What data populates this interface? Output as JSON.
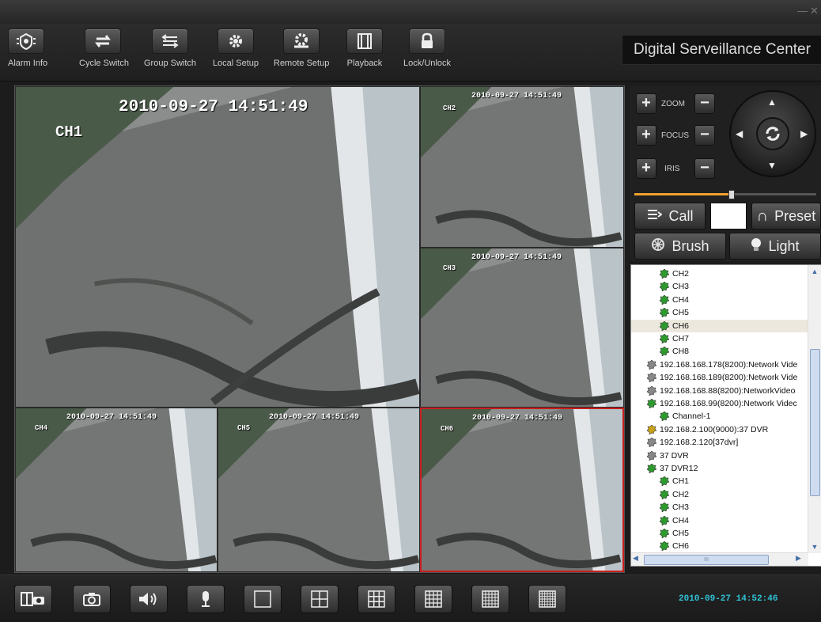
{
  "window": {
    "minimize": "—",
    "close": "✕"
  },
  "toolbar": {
    "buttons": [
      {
        "label": "Alarm Info",
        "icon": "alarm-icon"
      },
      {
        "label": "Cycle Switch",
        "icon": "cycle-icon"
      },
      {
        "label": "Group Switch",
        "icon": "group-switch-icon"
      },
      {
        "label": "Local Setup",
        "icon": "gear-icon"
      },
      {
        "label": "Remote Setup",
        "icon": "remote-gear-icon"
      },
      {
        "label": "Playback",
        "icon": "film-icon"
      },
      {
        "label": "Lock/Unlock",
        "icon": "lock-icon"
      }
    ],
    "brand": "Digital Serveillance Center"
  },
  "video": {
    "tiles": [
      {
        "ch": "CH1",
        "ts": "2010-09-27 14:51:49"
      },
      {
        "ch": "CH2",
        "ts": "2010-09-27 14:51:49"
      },
      {
        "ch": "CH3",
        "ts": "2010-09-27 14:51:49"
      },
      {
        "ch": "CH4",
        "ts": "2010-09-27 14:51:49"
      },
      {
        "ch": "CH5",
        "ts": "2010-09-27 14:51:49"
      },
      {
        "ch": "CH6",
        "ts": "2010-09-27 14:51:49"
      }
    ],
    "selected_channel": "CH6"
  },
  "ptz": {
    "zoom": "ZOOM",
    "focus": "FOCUS",
    "iris": "IRIS",
    "plus": "+",
    "minus": "−",
    "speed_level": 0.53,
    "call": "Call",
    "preset": "Preset",
    "brush": "Brush",
    "light": "Light"
  },
  "tree": {
    "items": [
      "CH2",
      "CH3",
      "CH4",
      "CH5",
      "CH6",
      "CH7",
      "CH8",
      "192.168.168.178(8200):Network Vide",
      "192.168.168.189(8200):Network Vide",
      "192.168.168.88(8200):NetworkVideo",
      "192.168.168.99(8200):Network Videc",
      "Channel-1",
      "192.168.2.100(9000):37 DVR",
      "192.168.2.120[37dvr]",
      "37 DVR",
      "37 DVR12",
      "CH1",
      "CH2",
      "CH3",
      "CH4",
      "CH5",
      "CH6"
    ],
    "hscroll_thumb": "III"
  },
  "bottom": {
    "buttons": [
      "record-snapshot-icon",
      "camera-icon",
      "speaker-icon",
      "microphone-icon",
      "layout-1-icon",
      "layout-4-icon",
      "layout-9-icon",
      "layout-16-icon",
      "layout-25-icon",
      "layout-36-icon"
    ],
    "clock": "2010-09-27 14:52:46"
  },
  "colors": {
    "accent": "#2fc2d6",
    "selected_border": "#c81e1e",
    "slider": "#f0a030"
  }
}
